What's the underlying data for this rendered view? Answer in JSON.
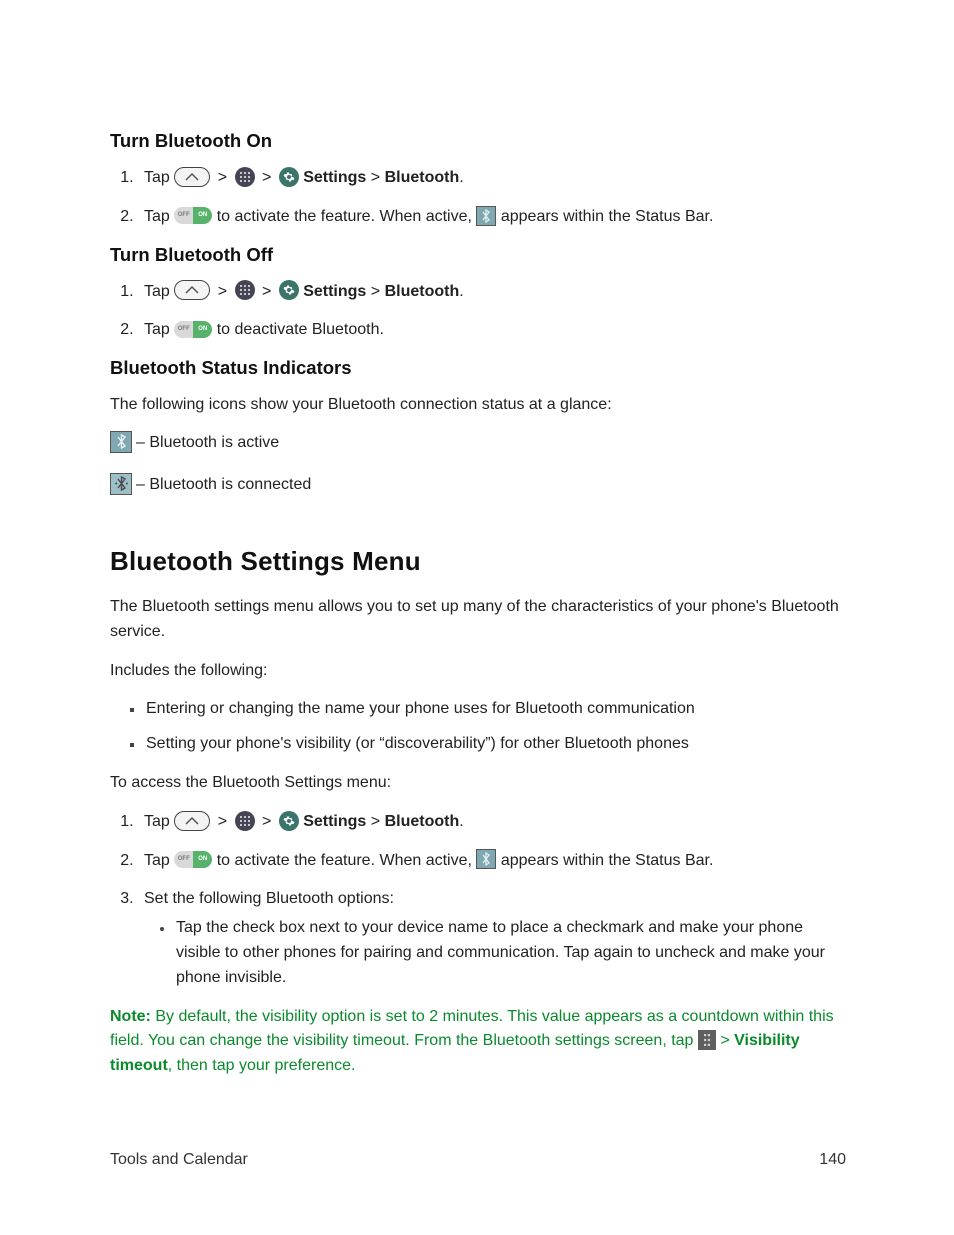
{
  "headings": {
    "turn_on": "Turn Bluetooth On",
    "turn_off": "Turn Bluetooth Off",
    "status_ind": "Bluetooth Status Indicators",
    "menu_title": "Bluetooth Settings Menu"
  },
  "common": {
    "tap": "Tap ",
    "gt": ">",
    "settings": " Settings ",
    "bluetooth": " Bluetooth",
    "period": "."
  },
  "on_step2_a": " to activate the feature. When active, ",
  "on_step2_b": " appears within the Status Bar.",
  "off_step2": " to deactivate Bluetooth.",
  "status_intro": "The following icons show your Bluetooth connection status at a glance:",
  "status_active": " – Bluetooth is active",
  "status_connected": " – Bluetooth is connected",
  "menu_intro": "The Bluetooth settings menu allows you to set up many of the characteristics of your phone's Bluetooth service.",
  "includes_label": "Includes the following:",
  "includes": [
    "Entering or changing the name your phone uses for Bluetooth communication",
    "Setting your phone's visibility (or “discoverability”) for other Bluetooth phones"
  ],
  "access_label": "To access the Bluetooth Settings menu:",
  "step3_intro": "Set the following Bluetooth options:",
  "step3_bullet": "Tap the check box next to your device name to place a checkmark and make your phone visible to other phones for pairing and communication. Tap again to uncheck and make your phone invisible.",
  "note_label": "Note:",
  "note_1": " By default, the visibility option is set to 2 minutes. This value appears as a countdown within this field. You can change the visibility timeout. From the Bluetooth settings screen, tap ",
  "note_2": " > ",
  "note_vis": "Visibility timeout",
  "note_3": ", then tap your preference.",
  "footer": {
    "left": "Tools and Calendar",
    "page": "140"
  }
}
